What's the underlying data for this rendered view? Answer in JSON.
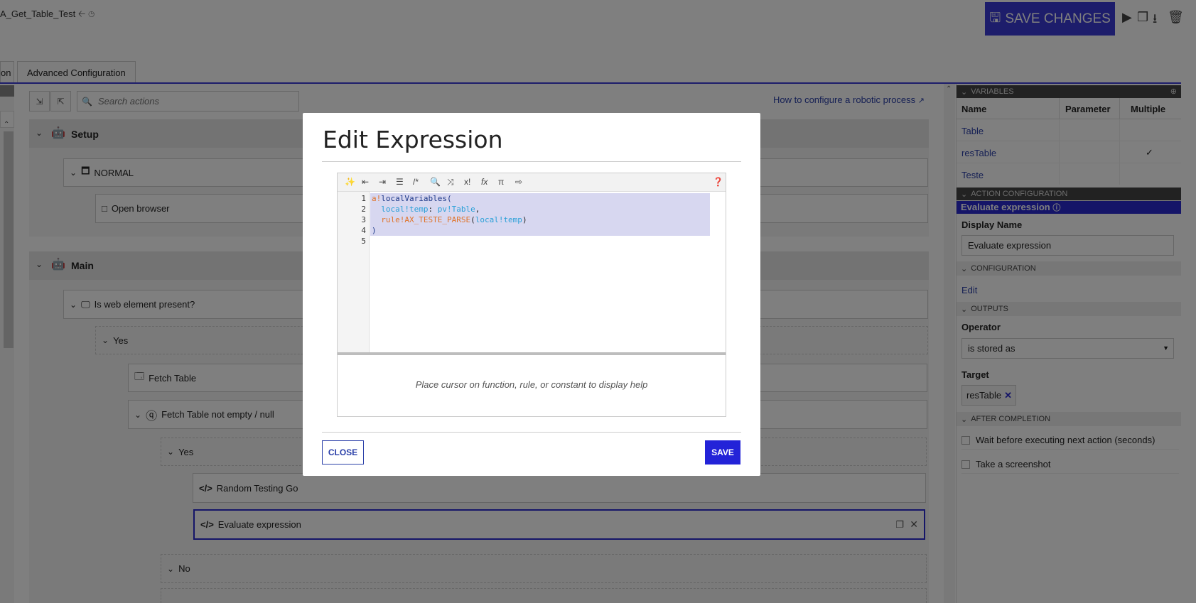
{
  "header": {
    "process_title": "A_Get_Table_Test",
    "save_changes_label": "SAVE CHANGES"
  },
  "tabs": [
    {
      "label": "on"
    },
    {
      "label": "Advanced Configuration"
    }
  ],
  "flow": {
    "search_placeholder": "Search actions",
    "help_link": "How to configure a robotic process",
    "setup_label": "Setup",
    "normal_label": "NORMAL",
    "open_browser_label": "Open browser",
    "main_label": "Main",
    "is_web_element_label": "Is web element present?",
    "yes1_label": "Yes",
    "fetch_table_label": "Fetch Table",
    "fetch_not_empty_label": "Fetch Table not empty / null",
    "yes2_label": "Yes",
    "random_testing_label": "Random Testing Go",
    "evaluate_expression_label": "Evaluate expression",
    "no_label": "No"
  },
  "right_panel": {
    "variables_header": "VARIABLES",
    "col_name": "Name",
    "col_parameter": "Parameter",
    "col_multiple": "Multiple",
    "variables": [
      {
        "name": "Table",
        "multiple": ""
      },
      {
        "name": "resTable",
        "multiple": "✓"
      },
      {
        "name": "Teste",
        "multiple": ""
      }
    ],
    "action_config_header": "ACTION CONFIGURATION",
    "action_title": "Evaluate expression",
    "display_name_label": "Display Name",
    "display_name_value": "Evaluate expression",
    "configuration_header": "CONFIGURATION",
    "edit_link": "Edit",
    "outputs_header": "OUTPUTS",
    "operator_label": "Operator",
    "operator_value": "is stored as",
    "target_label": "Target",
    "target_value": "resTable",
    "after_completion_header": "AFTER COMPLETION",
    "wait_label": "Wait before executing next action (seconds)",
    "screenshot_label": "Take a screenshot"
  },
  "modal": {
    "title": "Edit Expression",
    "line_numbers": [
      "1",
      "2",
      "3",
      "4",
      "5"
    ],
    "code": {
      "l1_a": "a!",
      "l1_b": "localVariables(",
      "l2_a": "  local!temp",
      "l2_b": ": ",
      "l2_c": "pv!Table",
      "l2_d": ",",
      "l3_a": "  rule!AX_TESTE_PARSE",
      "l3_b": "(",
      "l3_c": "local!temp",
      "l3_d": ")",
      "l4": ")"
    },
    "help_text": "Place cursor on function, rule, or constant to display help",
    "close_label": "CLOSE",
    "save_label": "SAVE"
  }
}
